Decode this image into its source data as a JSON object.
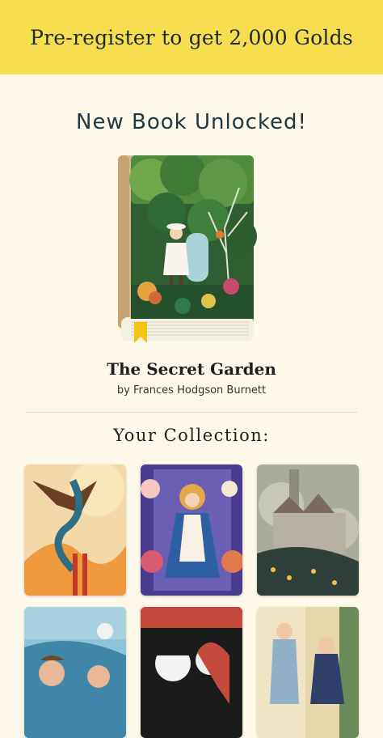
{
  "banner": {
    "text": "Pre-register to get 2,000 Golds"
  },
  "unlock": {
    "title": "New Book Unlocked!"
  },
  "book": {
    "title": "The Secret Garden",
    "author": "by Frances Hodgson Burnett"
  },
  "collection": {
    "title": "Your Collection:",
    "items": [
      {
        "name": "eagle-snake-cover"
      },
      {
        "name": "alice-flowers-cover"
      },
      {
        "name": "castle-hill-cover"
      },
      {
        "name": "sleeping-children-cover"
      },
      {
        "name": "dark-couple-cover"
      },
      {
        "name": "nurse-girl-cover"
      }
    ]
  },
  "colors": {
    "banner": "#f6de4f",
    "background": "#fdf8e9",
    "title": "#1e3742"
  }
}
